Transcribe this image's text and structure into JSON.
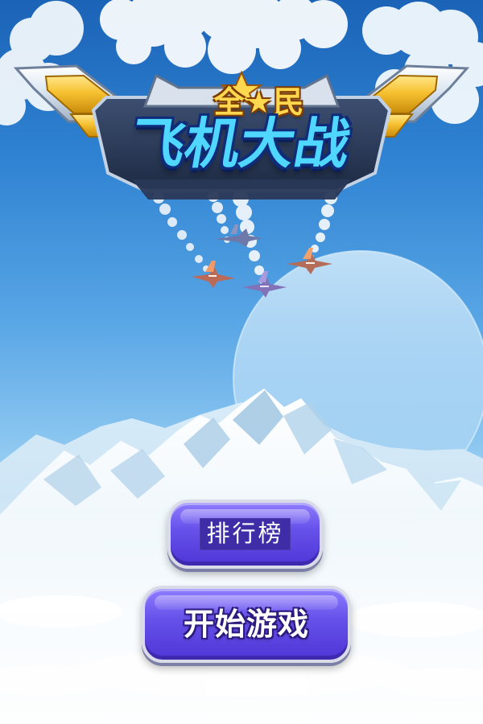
{
  "game": {
    "title_line1": "全★民",
    "title_line2": "飞机大战"
  },
  "menu": {
    "leaderboard_label": "排行榜",
    "start_label": "开始游戏"
  },
  "colors": {
    "sky_top": "#1b63b7",
    "sky_mid": "#5aa7e6",
    "sky_bottom": "#eef7fc",
    "button_purple": "#5e4af0",
    "button_border": "#d9dbe8",
    "logo_gold": "#ffd84f",
    "logo_blue": "#4fd7ff"
  }
}
